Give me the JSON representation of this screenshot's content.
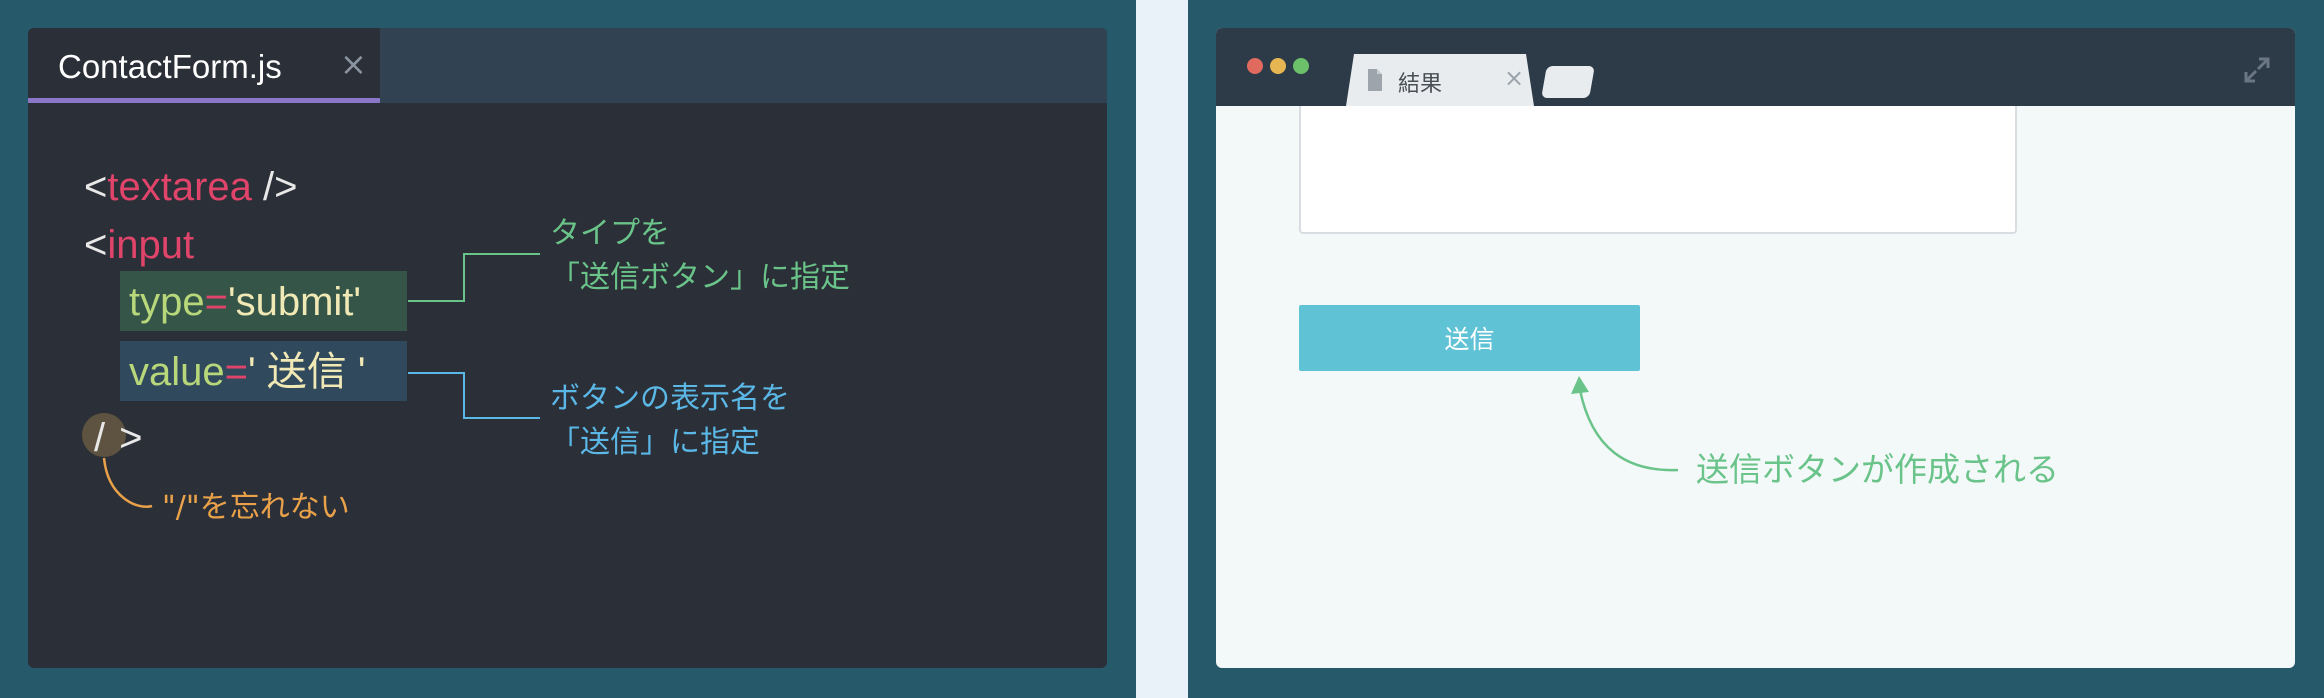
{
  "editor": {
    "tab_title": "ContactForm.js",
    "tab_close": "×",
    "code": {
      "lt": "<",
      "gt": ">",
      "slash_gt": " />",
      "textarea_tag": "textarea",
      "input_tag": "input",
      "type_attr": "type",
      "type_value": "'submit'",
      "value_attr": "value",
      "value_value": "' 送信 '",
      "eq": "=",
      "slash": "/"
    },
    "notes": {
      "type_line1": "タイプを",
      "type_line2": "「送信ボタン」に指定",
      "value_line1": "ボタンの表示名を",
      "value_line2": "「送信」に指定",
      "slash_note": "\"/\"を忘れない"
    }
  },
  "browser": {
    "tab_title": "結果",
    "tab_close": "×",
    "submit_label": "送信",
    "note": "送信ボタンが作成される"
  },
  "colors": {
    "panel_bg": "#26596a",
    "editor_bg": "#2b2f37",
    "tag": "#e0446a",
    "attr": "#b7d77a",
    "green_note": "#6ac48a",
    "blue_note": "#5ab7e6",
    "orange_note": "#e9a14a",
    "button": "#60c2d5"
  },
  "icons": {
    "file": "file-icon",
    "expand": "expand-icon"
  }
}
